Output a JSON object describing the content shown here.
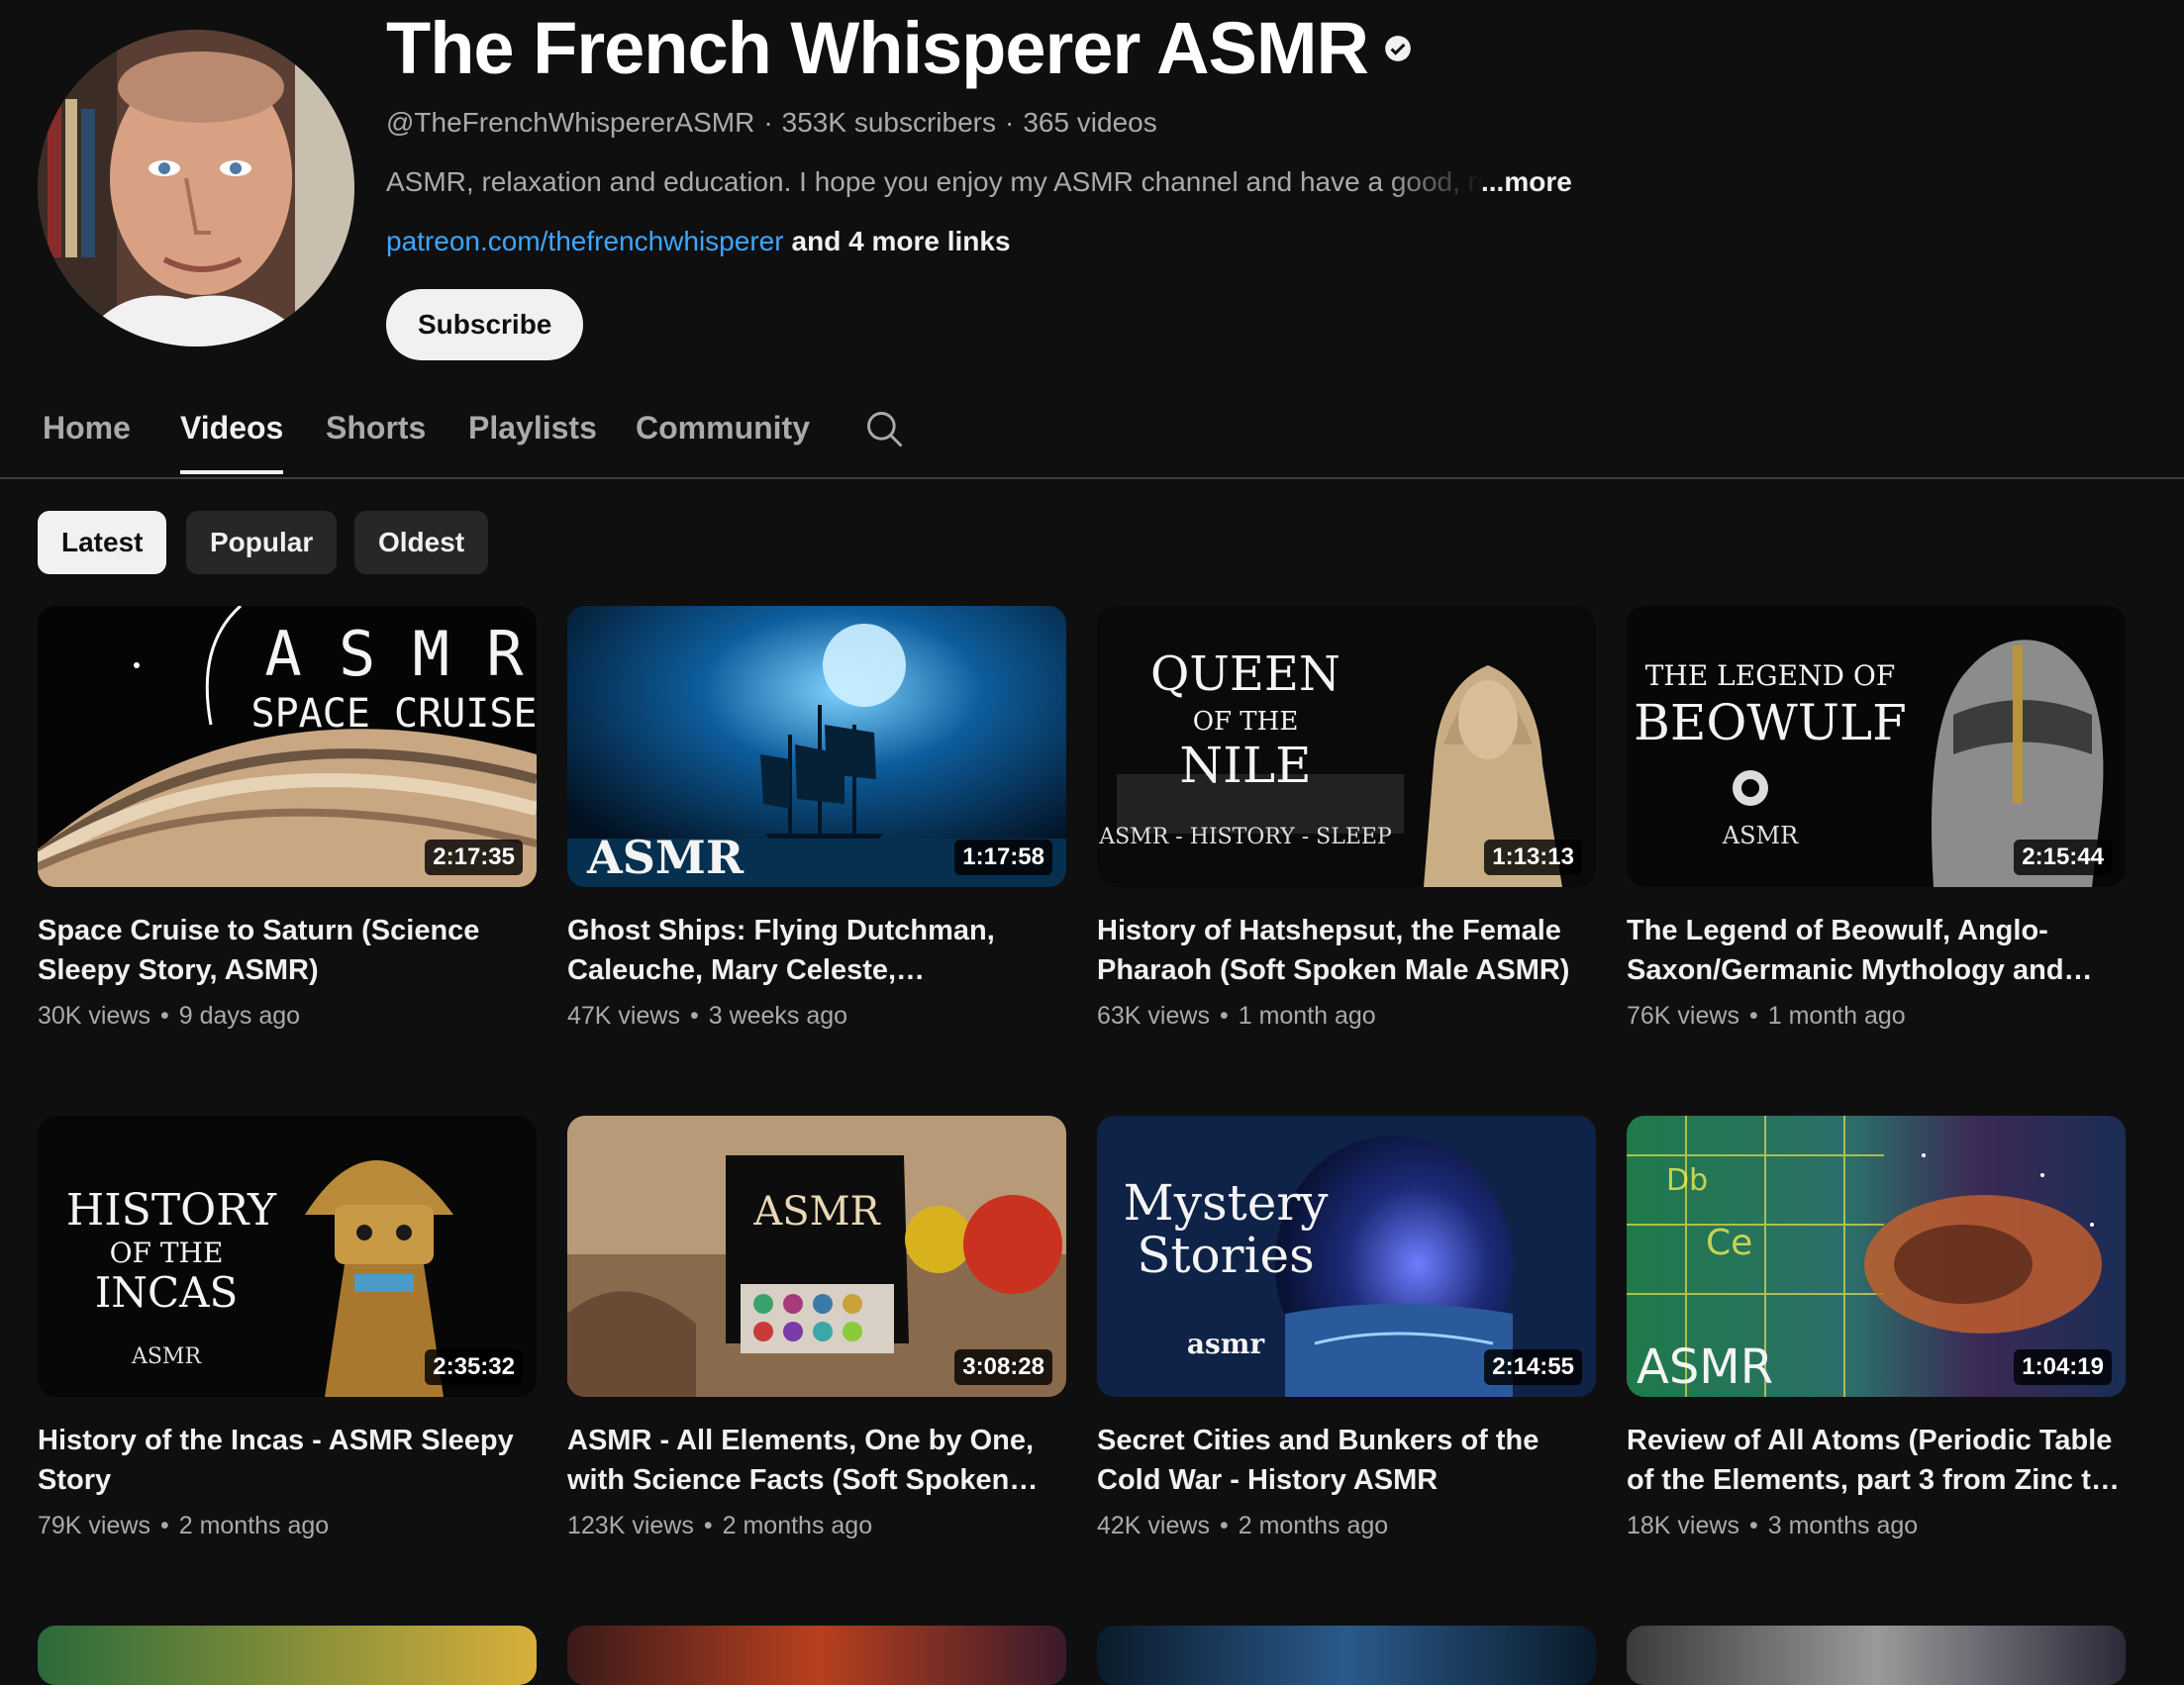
{
  "channel": {
    "name": "The French Whisperer ASMR",
    "handle": "@TheFrenchWhispererASMR",
    "subscribers": "353K subscribers",
    "videos_count": "365 videos",
    "separator": "·",
    "description": "ASMR, relaxation and education. I hope you enjoy my ASMR channel and have a good, relaxing time",
    "more_label": "...more",
    "link": "patreon.com/thefrenchwhisperer",
    "more_links": "and 4 more links",
    "subscribe_label": "Subscribe"
  },
  "tabs": [
    {
      "label": "Home",
      "active": false
    },
    {
      "label": "Videos",
      "active": true
    },
    {
      "label": "Shorts",
      "active": false
    },
    {
      "label": "Playlists",
      "active": false
    },
    {
      "label": "Community",
      "active": false
    }
  ],
  "filters": [
    {
      "label": "Latest",
      "active": true
    },
    {
      "label": "Popular",
      "active": false
    },
    {
      "label": "Oldest",
      "active": false
    }
  ],
  "videos": [
    {
      "title": "Space Cruise to Saturn (Science Sleepy Story, ASMR)",
      "views": "30K views",
      "age": "9 days ago",
      "duration": "2:17:35",
      "thumb_text": [
        "A S M R",
        "SPACE CRUISE"
      ]
    },
    {
      "title": "Ghost Ships: Flying Dutchman, Caleuche, Mary Celeste, Baychimo…",
      "views": "47K views",
      "age": "3 weeks ago",
      "duration": "1:17:58",
      "thumb_text": [
        "ASMR"
      ]
    },
    {
      "title": "History of Hatshepsut, the Female Pharaoh (Soft Spoken Male ASMR)",
      "views": "63K views",
      "age": "1 month ago",
      "duration": "1:13:13",
      "thumb_text": [
        "QUEEN",
        "OF THE",
        "NILE",
        "ASMR - HISTORY - SLEEP"
      ]
    },
    {
      "title": "The Legend of Beowulf, Anglo-Saxon/Germanic Mythology and…",
      "views": "76K views",
      "age": "1 month ago",
      "duration": "2:15:44",
      "thumb_text": [
        "THE LEGEND OF",
        "BEOWULF",
        "ASMR"
      ]
    },
    {
      "title": "History of the Incas - ASMR Sleepy Story",
      "views": "79K views",
      "age": "2 months ago",
      "duration": "2:35:32",
      "thumb_text": [
        "HISTORY",
        "OF THE",
        "INCAS",
        "ASMR"
      ]
    },
    {
      "title": "ASMR - All Elements, One by One, with Science Facts (Soft Spoken…",
      "views": "123K views",
      "age": "2 months ago",
      "duration": "3:08:28",
      "thumb_text": [
        "ASMR"
      ]
    },
    {
      "title": "Secret Cities and Bunkers of the Cold War - History ASMR",
      "views": "42K views",
      "age": "2 months ago",
      "duration": "2:14:55",
      "thumb_text": [
        "Mystery",
        "Stories",
        "asmr"
      ]
    },
    {
      "title": "Review of All Atoms (Periodic Table of the Elements, part 3 from Zinc t…",
      "views": "18K views",
      "age": "3 months ago",
      "duration": "1:04:19",
      "thumb_text": [
        "ASMR"
      ]
    }
  ],
  "icons": {
    "verified": "verified-check-icon",
    "search": "search-icon"
  },
  "colors": {
    "background": "#0f0f0f",
    "link": "#3ea6ff",
    "muted": "#aaaaaa",
    "chip": "#272727"
  }
}
